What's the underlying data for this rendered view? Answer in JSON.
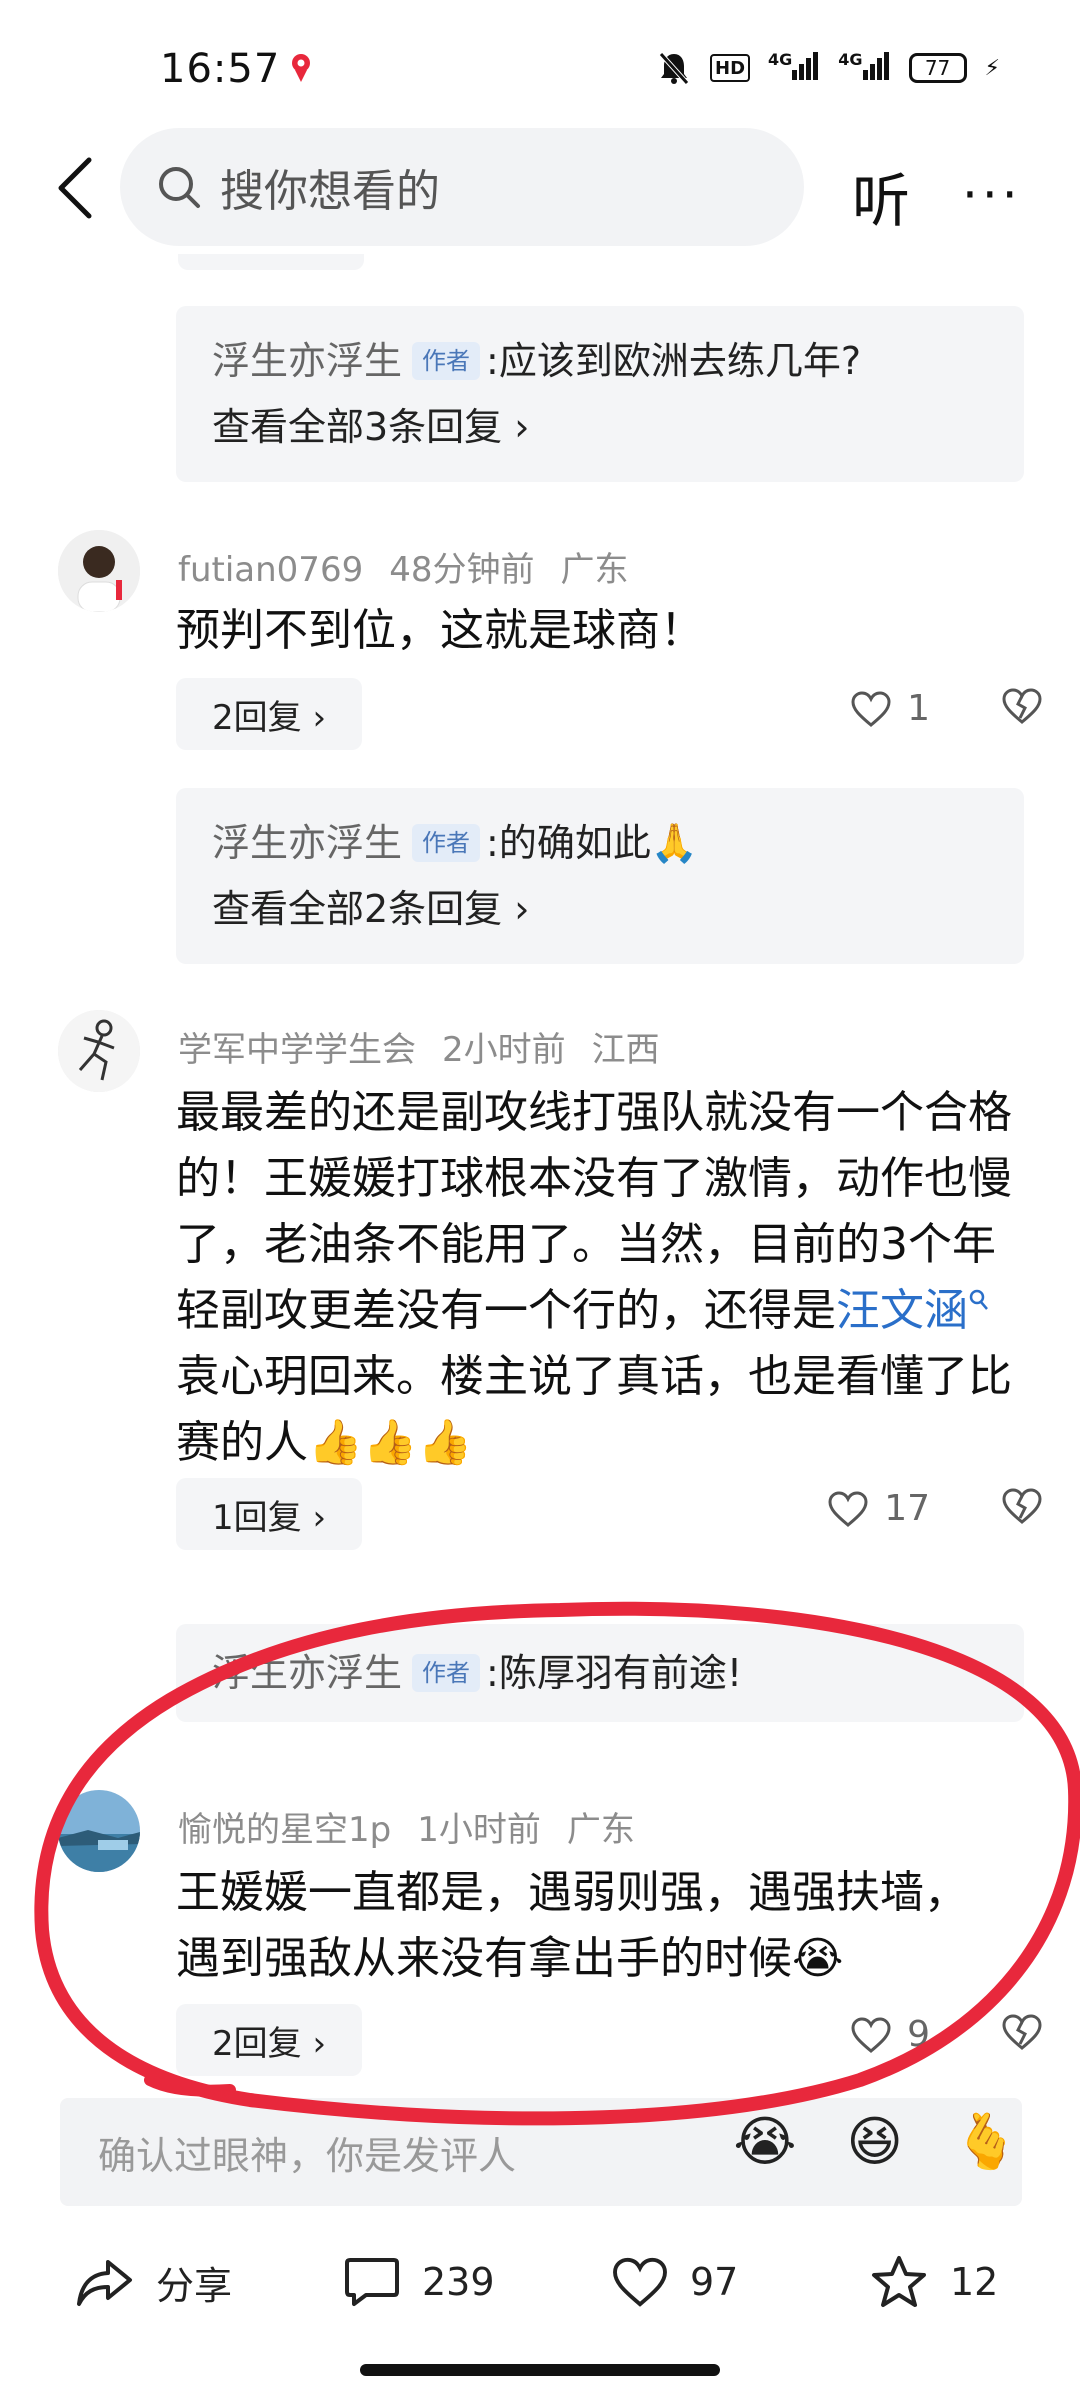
{
  "status_bar": {
    "time": "16:57",
    "network_labels": [
      "HD",
      "4G",
      "4G"
    ],
    "battery": "77"
  },
  "top_bar": {
    "search_placeholder": "搜你想看的",
    "listen_label": "听",
    "more_label": "···"
  },
  "threads": [
    {
      "reply_preview": {
        "author": "浮生亦浮生",
        "tag": "作者",
        "text": ":应该到欧洲去练几年?",
        "view_all": "查看全部3条回复 ›"
      }
    },
    {
      "comment": {
        "username": "futian0769",
        "time": "48分钟前",
        "location": "广东",
        "text": "预判不到位，这就是球商！",
        "replies_label": "2回复 ›",
        "likes": "1"
      },
      "reply_preview": {
        "author": "浮生亦浮生",
        "tag": "作者",
        "text": ":的确如此🙏",
        "view_all": "查看全部2条回复 ›"
      }
    },
    {
      "comment": {
        "username": "学军中学学生会",
        "time": "2小时前",
        "location": "江西",
        "text_before": "最最差的还是副攻线打强队就没有一个合格的！王媛媛打球根本没有了激情，动作也慢了，老油条不能用了。当然，目前的3个年轻副攻更差没有一个行的，还得是",
        "link": "汪文涵",
        "text_after": " 袁心玥回来。楼主说了真话，也是看懂了比赛的人👍👍👍",
        "replies_label": "1回复 ›",
        "likes": "17"
      },
      "reply_preview": {
        "author": "浮生亦浮生",
        "tag": "作者",
        "text": ":陈厚羽有前途!"
      }
    },
    {
      "comment": {
        "username": "愉悦的星空1p",
        "time": "1小时前",
        "location": "广东",
        "text": "王媛媛一直都是，遇弱则强，遇强扶墙，遇到强敌从来没有拿出手的时候😭",
        "replies_label": "2回复 ›",
        "likes": "9"
      }
    }
  ],
  "input_bar": {
    "placeholder": "确认过眼神，你是发评人",
    "emojis": [
      "😭",
      "😆",
      "🫰"
    ]
  },
  "bottom_bar": {
    "share_label": "分享",
    "comments_count": "239",
    "likes_count": "97",
    "favorites_count": "12"
  },
  "colors": {
    "link": "#2a6fc9",
    "annotation": "#e8283c",
    "author_tag_bg": "#e3ecf8",
    "author_tag_text": "#4a77b8"
  }
}
